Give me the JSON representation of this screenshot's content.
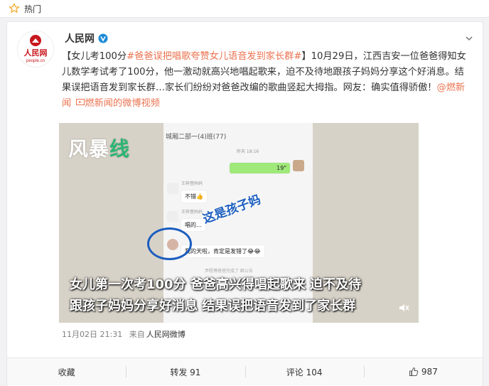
{
  "topbar": {
    "label": "热门"
  },
  "author": {
    "name": "人民网",
    "logo_text": "人民网",
    "logo_sub": "people.cn"
  },
  "post": {
    "topic1": "【女儿考100分",
    "topic2": "#爸爸误把唱歌夸赞女儿语音发到家长群#",
    "body": "】10月29日，江西吉安一位爸爸得知女儿数学考试考了100分，他一激动就高兴地唱起歌来，迫不及待地跟孩子妈妈分享这个好消息。结果误把语音发到家长群…家长们纷纷对爸爸改编的歌曲竖起大拇指。网友：确实值得骄傲！",
    "link1": "@燃新闻",
    "link2": "燃新闻的微博视频"
  },
  "video": {
    "watermark_a": "风暴",
    "watermark_b": "线",
    "chat_title": "城厢二部一(4)班(77)",
    "time": "昨天 18:16",
    "voice": "19\"",
    "msg1_name": "王梓萱妈妈",
    "msg1": "不错👍",
    "msg2_name": "王梓萱妈妈",
    "msg2": "唱的…",
    "msg3_name": "",
    "msg3": "我的天啦，肯定是发错了😂😂",
    "sys": "尹程博爸爸完成了 群公告",
    "callout": "这是孩子妈",
    "sub1": "女儿第一次考100分 爸爸高兴得唱起歌来 迫不及待",
    "sub2": "跟孩子妈妈分享好消息 结果误把语音发到了家长群"
  },
  "meta": {
    "time": "11月02日 21:31",
    "from_label": "来自",
    "source": "人民网微博"
  },
  "actions": {
    "fav": "收藏",
    "repost": "转发 91",
    "comment": "评论 104",
    "like": "987"
  },
  "colors": {
    "link": "#eb7350",
    "badge": "#1d8bd6"
  }
}
